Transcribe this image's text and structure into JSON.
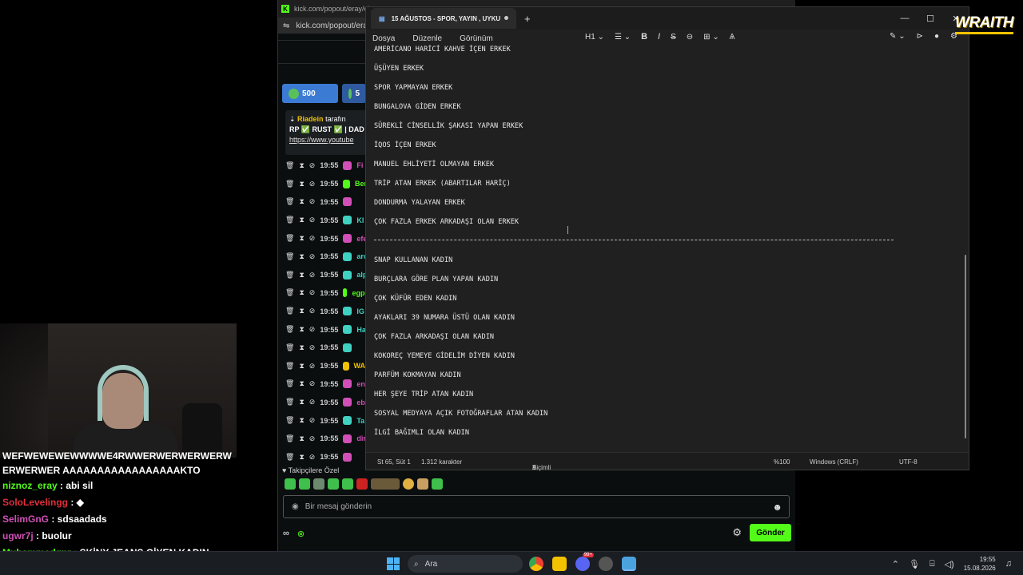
{
  "browser": {
    "tab_url": "kick.com/popout/eray/cha",
    "address": "kick.com/popout/era",
    "chip_points": "500",
    "chip_points_2": "5",
    "pinned": {
      "by": "Riadein",
      "by_suffix": "tarafın",
      "line2": "RP ✅ RUST ✅ | DAD",
      "link": "https://www.youtube"
    },
    "rows": [
      {
        "time": "19:55",
        "user": "Fi",
        "color": "#d14fb7"
      },
      {
        "time": "19:55",
        "user": "Berat",
        "color": "#53fc18"
      },
      {
        "time": "19:55",
        "user": "",
        "color": "#d14fb7"
      },
      {
        "time": "19:55",
        "user": "Kl",
        "color": "#3fd1c1"
      },
      {
        "time": "19:55",
        "user": "efe",
        "color": "#d14fb7"
      },
      {
        "time": "19:55",
        "user": "arc",
        "color": "#3fd1c1"
      },
      {
        "time": "19:55",
        "user": "alp",
        "color": "#3fd1c1"
      },
      {
        "time": "19:55",
        "user": "egpov",
        "color": "#53fc18"
      },
      {
        "time": "19:55",
        "user": "IG",
        "color": "#3fd1c1"
      },
      {
        "time": "19:55",
        "user": "Ha",
        "color": "#3fd1c1"
      },
      {
        "time": "19:55",
        "user": "",
        "color": "#3fd1c1"
      },
      {
        "time": "19:55",
        "user": "WAMI",
        "color": "#f2c200"
      },
      {
        "time": "19:55",
        "user": "en",
        "color": "#d14fb7"
      },
      {
        "time": "19:55",
        "user": "eb",
        "color": "#d14fb7"
      },
      {
        "time": "19:55",
        "user": "Ta",
        "color": "#3fd1c1"
      },
      {
        "time": "19:55",
        "user": "dir",
        "color": "#d14fb7"
      },
      {
        "time": "19:55",
        "user": "",
        "color": "#d14fb7"
      }
    ],
    "followers_label": "♥ Takipçilere Özel",
    "message_placeholder": "Bir mesaj gönderin",
    "send_label": "Gönder"
  },
  "overlay_chat": [
    {
      "user": "",
      "text": "WEFWEWEWEWWWWE4RWWERWERWERWERWERWERWER AAAAAAAAAAAAAAAAAKTO",
      "color": "#ffffff",
      "shout": true
    },
    {
      "user": "niznoz_eray",
      "text": " : abi sil",
      "color": "#53fc18"
    },
    {
      "user": "SoloLevelingg",
      "text": " : ◆",
      "color": "#e02f3b"
    },
    {
      "user": "SelimGnG",
      "text": " : sdsaadads",
      "color": "#d14fb7"
    },
    {
      "user": "ugwr7j",
      "text": " : buolur",
      "color": "#d14fb7"
    },
    {
      "user": "Muhammedgnr",
      "text": " : SKİNY JEANS GİYEN KADIN",
      "color": "#53fc18"
    }
  ],
  "notepad": {
    "tab_title": "15 AĞUSTOS - SPOR, YAYIN , UYKU",
    "menu": [
      "Dosya",
      "Düzenle",
      "Görünüm"
    ],
    "heading_level": "H1",
    "lines_top": [
      "AMERİCANO HARİCİ KAHVE İÇEN ERKEK",
      "ÜŞÜYEN ERKEK",
      "SPOR YAPMAYAN ERKEK",
      "BUNGALOVA GİDEN ERKEK",
      "SÜREKLİ CİNSELLİK ŞAKASI YAPAN ERKEK",
      "İQOS İÇEN ERKEK",
      "MANUEL EHLİYETİ OLMAYAN ERKEK",
      "TRİP ATAN ERKEK (ABARTILAR HARİÇ)",
      "DONDURMA YALAYAN ERKEK",
      "ÇOK FAZLA ERKEK ARKADAŞI OLAN ERKEK"
    ],
    "lines_bottom": [
      "SNAP KULLANAN KADIN",
      "BURÇLARA GÖRE PLAN YAPAN KADIN",
      "ÇOK KÜFÜR EDEN KADIN",
      "AYAKLARI 39 NUMARA ÜSTÜ OLAN KADIN",
      "ÇOK FAZLA ARKADAŞI OLAN KADIN",
      "KOKOREÇ YEMEYE GİDELİM DİYEN KADIN",
      "PARFÜM KOKMAYAN KADIN",
      "HER ŞEYE TRİP ATAN KADIN",
      "SOSYAL MEDYAYA AÇIK FOTOĞRAFLAR ATAN KADIN",
      "İLGİ BAĞIMLI OLAN KADIN"
    ],
    "status": {
      "position": "St 65, Süt 1",
      "chars": "1.312 karakter",
      "mode": "Biçimli",
      "zoom": "%100",
      "eol": "Windows (CRLF)",
      "encoding": "UTF-8"
    }
  },
  "logo": "WRAITH",
  "taskbar": {
    "search_label": "Ara",
    "time": "19:55",
    "date": "15.08.2026",
    "notif_count": "99+"
  }
}
